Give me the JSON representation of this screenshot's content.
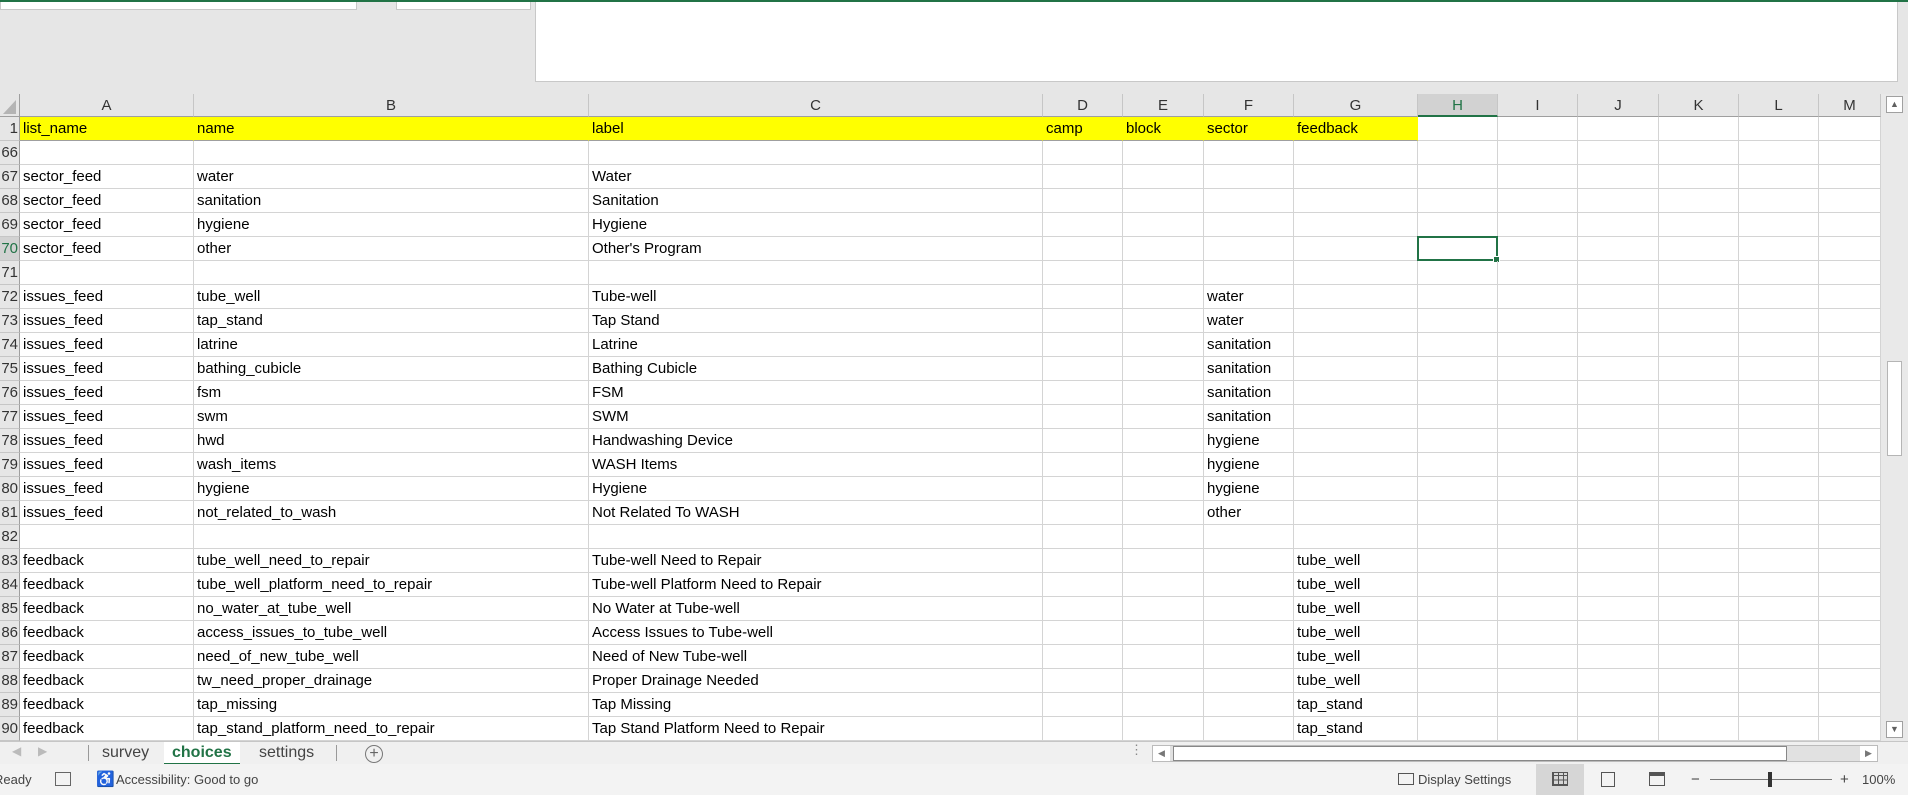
{
  "columns": [
    "A",
    "B",
    "C",
    "D",
    "E",
    "F",
    "G",
    "H",
    "I",
    "J",
    "K",
    "L",
    "M"
  ],
  "selected_cell": {
    "column": "H",
    "row": "70"
  },
  "header_row": {
    "num": "1",
    "cells": [
      "list_name",
      "name",
      "label",
      "camp",
      "block",
      "sector",
      "feedback"
    ]
  },
  "rows": [
    {
      "num": "66",
      "cells": [
        "",
        "",
        "",
        "",
        "",
        "",
        ""
      ]
    },
    {
      "num": "67",
      "cells": [
        "sector_feed",
        "water",
        "Water",
        "",
        "",
        "",
        ""
      ]
    },
    {
      "num": "68",
      "cells": [
        "sector_feed",
        "sanitation",
        "Sanitation",
        "",
        "",
        "",
        ""
      ]
    },
    {
      "num": "69",
      "cells": [
        "sector_feed",
        "hygiene",
        "Hygiene",
        "",
        "",
        "",
        ""
      ]
    },
    {
      "num": "70",
      "cells": [
        "sector_feed",
        "other",
        "Other's Program",
        "",
        "",
        "",
        ""
      ]
    },
    {
      "num": "71",
      "cells": [
        "",
        "",
        "",
        "",
        "",
        "",
        ""
      ]
    },
    {
      "num": "72",
      "cells": [
        "issues_feed",
        "tube_well",
        "Tube-well",
        "",
        "",
        "water",
        ""
      ]
    },
    {
      "num": "73",
      "cells": [
        "issues_feed",
        "tap_stand",
        "Tap Stand",
        "",
        "",
        "water",
        ""
      ]
    },
    {
      "num": "74",
      "cells": [
        "issues_feed",
        "latrine",
        "Latrine",
        "",
        "",
        "sanitation",
        ""
      ]
    },
    {
      "num": "75",
      "cells": [
        "issues_feed",
        "bathing_cubicle",
        "Bathing Cubicle",
        "",
        "",
        "sanitation",
        ""
      ]
    },
    {
      "num": "76",
      "cells": [
        "issues_feed",
        "fsm",
        "FSM",
        "",
        "",
        "sanitation",
        ""
      ]
    },
    {
      "num": "77",
      "cells": [
        "issues_feed",
        "swm",
        "SWM",
        "",
        "",
        "sanitation",
        ""
      ]
    },
    {
      "num": "78",
      "cells": [
        "issues_feed",
        "hwd",
        "Handwashing Device",
        "",
        "",
        "hygiene",
        ""
      ]
    },
    {
      "num": "79",
      "cells": [
        "issues_feed",
        "wash_items",
        "WASH Items",
        "",
        "",
        "hygiene",
        ""
      ]
    },
    {
      "num": "80",
      "cells": [
        "issues_feed",
        "hygiene",
        "Hygiene",
        "",
        "",
        "hygiene",
        ""
      ]
    },
    {
      "num": "81",
      "cells": [
        "issues_feed",
        "not_related_to_wash",
        "Not Related To WASH",
        "",
        "",
        "other",
        ""
      ]
    },
    {
      "num": "82",
      "cells": [
        "",
        "",
        "",
        "",
        "",
        "",
        ""
      ]
    },
    {
      "num": "83",
      "cells": [
        "feedback",
        "tube_well_need_to_repair",
        "Tube-well Need to Repair",
        "",
        "",
        "",
        "tube_well"
      ]
    },
    {
      "num": "84",
      "cells": [
        "feedback",
        "tube_well_platform_need_to_repair",
        "Tube-well Platform Need to Repair",
        "",
        "",
        "",
        "tube_well"
      ]
    },
    {
      "num": "85",
      "cells": [
        "feedback",
        "no_water_at_tube_well",
        "No Water at Tube-well",
        "",
        "",
        "",
        "tube_well"
      ]
    },
    {
      "num": "86",
      "cells": [
        "feedback",
        "access_issues_to_tube_well",
        "Access Issues to Tube-well",
        "",
        "",
        "",
        "tube_well"
      ]
    },
    {
      "num": "87",
      "cells": [
        "feedback",
        "need_of_new_tube_well",
        "Need of New Tube-well",
        "",
        "",
        "",
        "tube_well"
      ]
    },
    {
      "num": "88",
      "cells": [
        "feedback",
        "tw_need_proper_drainage",
        "Proper Drainage Needed",
        "",
        "",
        "",
        "tube_well"
      ]
    },
    {
      "num": "89",
      "cells": [
        "feedback",
        "tap_missing",
        "Tap Missing",
        "",
        "",
        "",
        "tap_stand"
      ]
    },
    {
      "num": "90",
      "cells": [
        "feedback",
        "tap_stand_platform_need_to_repair",
        "Tap Stand Platform Need to Repair",
        "",
        "",
        "",
        "tap_stand"
      ]
    }
  ],
  "sheet_tabs": [
    {
      "label": "survey"
    },
    {
      "label": "choices",
      "active": true
    },
    {
      "label": "settings"
    }
  ],
  "status": {
    "ready": "Ready",
    "accessibility": "Accessibility: Good to go",
    "display_settings": "Display Settings",
    "zoom": "100%",
    "zoom_minus": "−",
    "zoom_plus": "+"
  },
  "colors": {
    "accent": "#217346",
    "header_fill": "#ffff00"
  }
}
